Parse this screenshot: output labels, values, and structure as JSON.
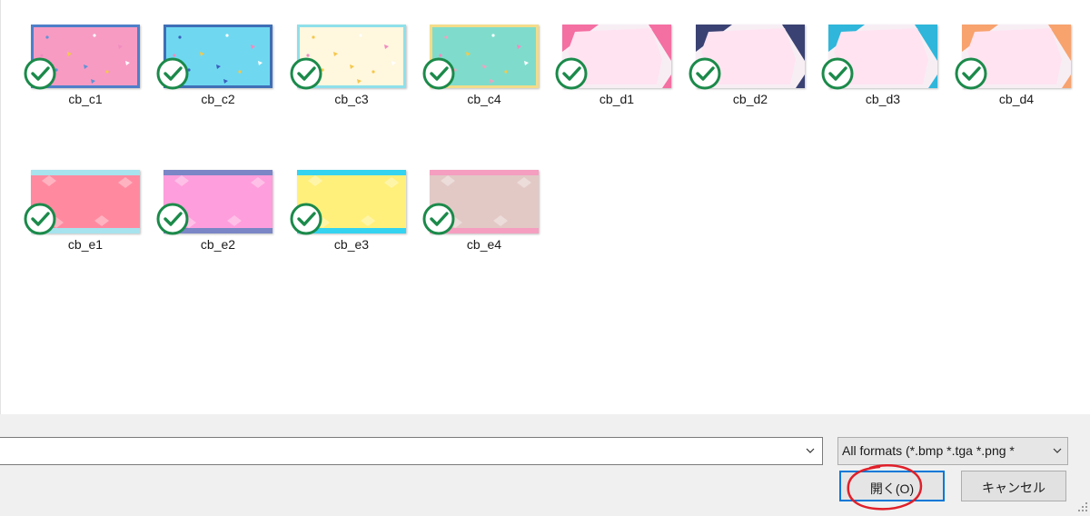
{
  "files": [
    {
      "name": "cb_c1",
      "design": "confetti",
      "bg": "#f79bc3",
      "border": "#4f7fc9",
      "accent": "#5c93d6"
    },
    {
      "name": "cb_c2",
      "design": "confetti",
      "bg": "#6fd8f0",
      "border": "#3f6fb6",
      "accent": "#3a5fbf"
    },
    {
      "name": "cb_c3",
      "design": "confetti",
      "bg": "#fff7de",
      "border": "#8fe0ea",
      "accent": "#f5c84a"
    },
    {
      "name": "cb_c4",
      "design": "confetti",
      "bg": "#7fdccc",
      "border": "#f3dc8a",
      "accent": "#f3a0c0"
    },
    {
      "name": "cb_d1",
      "design": "corner",
      "bg": "#ffe3f1",
      "corner": "#f46fa2"
    },
    {
      "name": "cb_d2",
      "design": "corner",
      "bg": "#ffe3f1",
      "corner": "#3a4273"
    },
    {
      "name": "cb_d3",
      "design": "corner",
      "bg": "#ffe3f1",
      "corner": "#2fb6da"
    },
    {
      "name": "cb_d4",
      "design": "corner",
      "bg": "#ffe3f1",
      "corner": "#f8a26e"
    },
    {
      "name": "cb_e1",
      "design": "stripe",
      "bg": "#ff8aa0",
      "band": "#a6e3ee"
    },
    {
      "name": "cb_e2",
      "design": "stripe",
      "bg": "#ff9edc",
      "band": "#7b86c6"
    },
    {
      "name": "cb_e3",
      "design": "stripe",
      "bg": "#fff07c",
      "band": "#34d3ef"
    },
    {
      "name": "cb_e4",
      "design": "stripe",
      "bg": "#e2c9c6",
      "band": "#f59ec0"
    }
  ],
  "check_color": "#1b8a4a",
  "filename": {
    "value": "",
    "placeholder": ""
  },
  "filetype": {
    "selected": "All formats (*.bmp *.tga *.png *"
  },
  "buttons": {
    "open": "開く(O)",
    "cancel": "キャンセル"
  },
  "annotation_color": "#e0202a",
  "icons": [
    "checkmark-badge-icon",
    "chevron-down-icon",
    "resize-grip-icon"
  ]
}
